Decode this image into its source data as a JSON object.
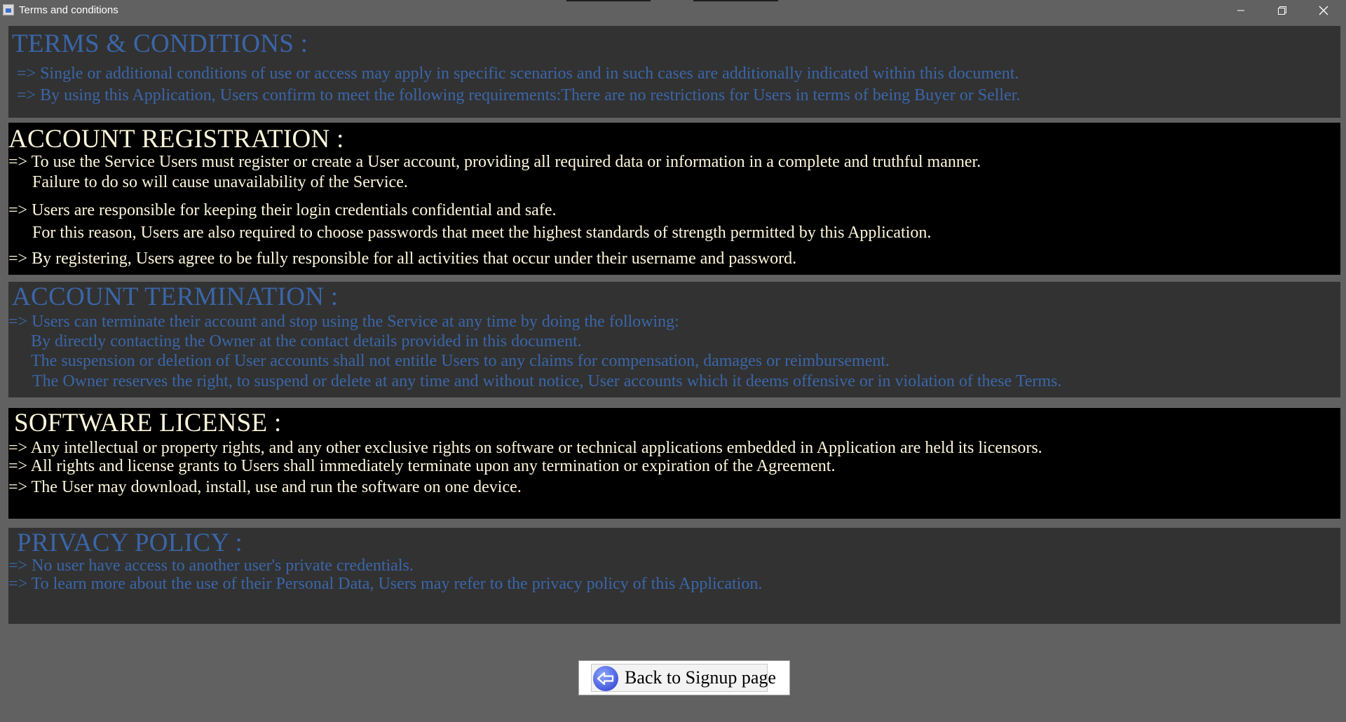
{
  "window": {
    "title": "Terms and conditions",
    "controls": {
      "minimize_icon": "minimize-icon",
      "maximize_icon": "restore-icon",
      "close_icon": "close-icon"
    }
  },
  "colors": {
    "background": "#616161",
    "panel_dark": "#323232",
    "panel_black": "#000000",
    "blue_text": "#3a66a8",
    "cream_text": "#fff7dc"
  },
  "sections": {
    "terms": {
      "heading": "TERMS & CONDITIONS :",
      "lines": [
        "=> Single or additional conditions of use or access may apply in specific scenarios and in such cases are additionally indicated within this document.",
        "=> By using this Application, Users confirm to meet the following requirements:There are no restrictions for Users in terms of being Buyer or Seller."
      ]
    },
    "registration": {
      "heading": "ACCOUNT REGISTRATION :",
      "lines": [
        "=> To use the Service Users must register or create a User account, providing all required data or information in a complete and truthful manner.",
        "Failure to do so will cause unavailability of the Service.",
        "=> Users are responsible for keeping their login credentials confidential and safe.",
        "For this reason, Users are also required to choose passwords that meet the highest standards of strength permitted by this Application.",
        "=> By registering, Users agree to be fully responsible for all activities that occur under their username and password."
      ]
    },
    "termination": {
      "heading": "ACCOUNT TERMINATION :",
      "lines": [
        "=> Users can terminate their account and stop using the Service at any time by doing the following:",
        "By directly contacting the Owner at the contact details provided in this document.",
        "The suspension or deletion of User accounts shall not entitle Users to any claims for compensation, damages or reimbursement.",
        "The Owner reserves the right, to suspend or delete at any time and without notice, User accounts which it deems offensive or in violation of these Terms."
      ]
    },
    "license": {
      "heading": "SOFTWARE LICENSE :",
      "lines": [
        "=> Any intellectual or property rights, and any other exclusive rights on software or technical applications embedded in Application are held its licensors.",
        "=> All rights and license grants to Users shall immediately terminate upon any termination or expiration of the Agreement.",
        "=> The User may download, install, use and run the software on one device."
      ]
    },
    "privacy": {
      "heading": "PRIVACY POLICY :",
      "lines": [
        "=> No user have access to another user's private credentials.",
        "=> To learn more about the use of their Personal Data, Users may refer to the privacy policy of this Application."
      ]
    }
  },
  "back_button": {
    "label": "Back to Signup page",
    "icon": "back-arrow-icon"
  }
}
